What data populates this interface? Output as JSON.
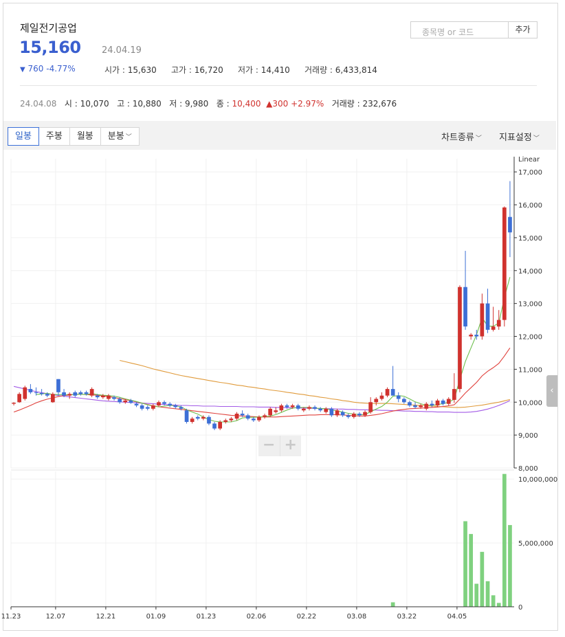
{
  "stock": {
    "name": "제일전기공업",
    "price": "15,160",
    "date": "24.04.19",
    "change_arrow": "▼",
    "change": "760 -4.77%",
    "open_label": "시가 : ",
    "open": "15,630",
    "high_label": "고가 : ",
    "high": "16,720",
    "low_label": "저가 : ",
    "low": "14,410",
    "volume_label": "거래량 : ",
    "volume": "6,433,814"
  },
  "search": {
    "placeholder": "종목명 or 코드",
    "add_label": "추가"
  },
  "hover_row": {
    "date": "24.04.08",
    "open_label": "시 : ",
    "open": "10,070",
    "high_label": "고 : ",
    "high": "10,880",
    "low_label": "저 : ",
    "low": "9,980",
    "close_label": "종 : ",
    "close": "10,400",
    "change_arrow": "▲",
    "change": "300 +2.97%",
    "volume_label": "거래량 : ",
    "volume": "232,676"
  },
  "toolbar": {
    "tabs": [
      {
        "label": "일봉"
      },
      {
        "label": "주봉"
      },
      {
        "label": "월봉"
      },
      {
        "label": "분봉"
      }
    ],
    "chart_type": "차트종류",
    "indicator": "지표설정"
  },
  "colors": {
    "up": "#d0322e",
    "down": "#3d6fd6",
    "volume": "#7fd17f",
    "ma5": "#6cbf4d",
    "ma20": "#e0413c",
    "ma60": "#e09a3a",
    "ma120": "#a259e6"
  },
  "icons": {
    "side_handle": "chevron-left-icon",
    "zoom_out": "minus-icon",
    "zoom_in": "plus-icon"
  },
  "chart_data": {
    "type": "candlestick",
    "scale_label": "Linear",
    "x_ticks": [
      "11.23",
      "12.07",
      "12.21",
      "01.09",
      "01.23",
      "02.06",
      "02.22",
      "03.08",
      "03.22",
      "04.05"
    ],
    "price_ylim": [
      8000,
      17400
    ],
    "price_ticks": [
      "17,000",
      "16,000",
      "15,000",
      "14,000",
      "13,000",
      "12,000",
      "11,000",
      "10,000",
      "9,000",
      "8,000"
    ],
    "volume_ylim": [
      0,
      10600000
    ],
    "volume_ticks": [
      "10,000,000",
      "5,000,000",
      "0"
    ],
    "candles": [
      {
        "o": 9950,
        "h": 10000,
        "l": 9900,
        "c": 9980
      },
      {
        "o": 10000,
        "h": 10300,
        "l": 9980,
        "c": 10250
      },
      {
        "o": 10100,
        "h": 10500,
        "l": 10050,
        "c": 10450
      },
      {
        "o": 10400,
        "h": 10550,
        "l": 10250,
        "c": 10300
      },
      {
        "o": 10300,
        "h": 10450,
        "l": 10200,
        "c": 10280
      },
      {
        "o": 10280,
        "h": 10400,
        "l": 10200,
        "c": 10250
      },
      {
        "o": 10250,
        "h": 10300,
        "l": 10150,
        "c": 10200
      },
      {
        "o": 10000,
        "h": 10300,
        "l": 9980,
        "c": 10250
      },
      {
        "o": 10700,
        "h": 10700,
        "l": 10200,
        "c": 10300
      },
      {
        "o": 10300,
        "h": 10400,
        "l": 10150,
        "c": 10200
      },
      {
        "o": 10200,
        "h": 10300,
        "l": 10100,
        "c": 10250
      },
      {
        "o": 10300,
        "h": 10350,
        "l": 10150,
        "c": 10200
      },
      {
        "o": 10300,
        "h": 10350,
        "l": 10200,
        "c": 10250
      },
      {
        "o": 10300,
        "h": 10350,
        "l": 10200,
        "c": 10250
      },
      {
        "o": 10200,
        "h": 10450,
        "l": 10150,
        "c": 10400
      },
      {
        "o": 10200,
        "h": 10250,
        "l": 10100,
        "c": 10150
      },
      {
        "o": 10150,
        "h": 10250,
        "l": 10100,
        "c": 10200
      },
      {
        "o": 10100,
        "h": 10250,
        "l": 10050,
        "c": 10200
      },
      {
        "o": 10150,
        "h": 10200,
        "l": 10050,
        "c": 10100
      },
      {
        "o": 10100,
        "h": 10150,
        "l": 9950,
        "c": 10000
      },
      {
        "o": 10000,
        "h": 10100,
        "l": 9950,
        "c": 10050
      },
      {
        "o": 10050,
        "h": 10100,
        "l": 9950,
        "c": 9980
      },
      {
        "o": 9950,
        "h": 10000,
        "l": 9850,
        "c": 9900
      },
      {
        "o": 9900,
        "h": 9950,
        "l": 9750,
        "c": 9800
      },
      {
        "o": 9850,
        "h": 9900,
        "l": 9750,
        "c": 9800
      },
      {
        "o": 9800,
        "h": 9950,
        "l": 9750,
        "c": 9900
      },
      {
        "o": 9900,
        "h": 10050,
        "l": 9850,
        "c": 10000
      },
      {
        "o": 10000,
        "h": 10050,
        "l": 9900,
        "c": 9950
      },
      {
        "o": 9950,
        "h": 10000,
        "l": 9850,
        "c": 9900
      },
      {
        "o": 9900,
        "h": 9950,
        "l": 9800,
        "c": 9850
      },
      {
        "o": 9850,
        "h": 9900,
        "l": 9750,
        "c": 9800
      },
      {
        "o": 9750,
        "h": 9800,
        "l": 9350,
        "c": 9400
      },
      {
        "o": 9400,
        "h": 9550,
        "l": 9350,
        "c": 9500
      },
      {
        "o": 9550,
        "h": 9600,
        "l": 9450,
        "c": 9500
      },
      {
        "o": 9500,
        "h": 9600,
        "l": 9450,
        "c": 9550
      },
      {
        "o": 9550,
        "h": 9600,
        "l": 9300,
        "c": 9350
      },
      {
        "o": 9350,
        "h": 9400,
        "l": 9150,
        "c": 9200
      },
      {
        "o": 9200,
        "h": 9450,
        "l": 9150,
        "c": 9400
      },
      {
        "o": 9400,
        "h": 9500,
        "l": 9350,
        "c": 9450
      },
      {
        "o": 9450,
        "h": 9550,
        "l": 9400,
        "c": 9500
      },
      {
        "o": 9500,
        "h": 9700,
        "l": 9450,
        "c": 9650
      },
      {
        "o": 9650,
        "h": 9750,
        "l": 9550,
        "c": 9600
      },
      {
        "o": 9600,
        "h": 9650,
        "l": 9450,
        "c": 9500
      },
      {
        "o": 9500,
        "h": 9550,
        "l": 9400,
        "c": 9450
      },
      {
        "o": 9450,
        "h": 9600,
        "l": 9400,
        "c": 9550
      },
      {
        "o": 9550,
        "h": 9650,
        "l": 9500,
        "c": 9600
      },
      {
        "o": 9600,
        "h": 9850,
        "l": 9550,
        "c": 9800
      },
      {
        "o": 9700,
        "h": 9850,
        "l": 9650,
        "c": 9750
      },
      {
        "o": 9750,
        "h": 9950,
        "l": 9700,
        "c": 9900
      },
      {
        "o": 9900,
        "h": 9950,
        "l": 9800,
        "c": 9850
      },
      {
        "o": 9850,
        "h": 9950,
        "l": 9800,
        "c": 9900
      },
      {
        "o": 9900,
        "h": 9950,
        "l": 9750,
        "c": 9800
      },
      {
        "o": 9750,
        "h": 9850,
        "l": 9700,
        "c": 9800
      },
      {
        "o": 9800,
        "h": 9900,
        "l": 9750,
        "c": 9850
      },
      {
        "o": 9850,
        "h": 9900,
        "l": 9750,
        "c": 9800
      },
      {
        "o": 9800,
        "h": 9850,
        "l": 9700,
        "c": 9750
      },
      {
        "o": 9700,
        "h": 9850,
        "l": 9650,
        "c": 9800
      },
      {
        "o": 9800,
        "h": 9850,
        "l": 9550,
        "c": 9600
      },
      {
        "o": 9600,
        "h": 9800,
        "l": 9550,
        "c": 9750
      },
      {
        "o": 9700,
        "h": 9750,
        "l": 9550,
        "c": 9600
      },
      {
        "o": 9600,
        "h": 9650,
        "l": 9500,
        "c": 9550
      },
      {
        "o": 9550,
        "h": 9700,
        "l": 9500,
        "c": 9650
      },
      {
        "o": 9650,
        "h": 9700,
        "l": 9550,
        "c": 9600
      },
      {
        "o": 9600,
        "h": 9750,
        "l": 9550,
        "c": 9700
      },
      {
        "o": 9700,
        "h": 10150,
        "l": 9650,
        "c": 10000
      },
      {
        "o": 10000,
        "h": 10150,
        "l": 9900,
        "c": 10100
      },
      {
        "o": 10100,
        "h": 10300,
        "l": 10050,
        "c": 10200
      },
      {
        "o": 10200,
        "h": 10450,
        "l": 10150,
        "c": 10400
      },
      {
        "o": 10400,
        "h": 11100,
        "l": 10250,
        "c": 10200
      },
      {
        "o": 10200,
        "h": 10300,
        "l": 10000,
        "c": 10100
      },
      {
        "o": 10100,
        "h": 10150,
        "l": 9950,
        "c": 10000
      },
      {
        "o": 10000,
        "h": 10050,
        "l": 9850,
        "c": 9900
      },
      {
        "o": 9900,
        "h": 10000,
        "l": 9800,
        "c": 9850
      },
      {
        "o": 9850,
        "h": 9950,
        "l": 9800,
        "c": 9900
      },
      {
        "o": 9800,
        "h": 10000,
        "l": 9750,
        "c": 9950
      },
      {
        "o": 9950,
        "h": 10050,
        "l": 9850,
        "c": 9900
      },
      {
        "o": 9900,
        "h": 10100,
        "l": 9850,
        "c": 10050
      },
      {
        "o": 10050,
        "h": 10100,
        "l": 9900,
        "c": 9950
      },
      {
        "o": 9950,
        "h": 10150,
        "l": 9900,
        "c": 10100
      },
      {
        "o": 10070,
        "h": 10880,
        "l": 9980,
        "c": 10400
      },
      {
        "o": 10400,
        "h": 13550,
        "l": 10300,
        "c": 13500
      },
      {
        "o": 13500,
        "h": 14600,
        "l": 12200,
        "c": 12300
      },
      {
        "o": 12000,
        "h": 12100,
        "l": 11900,
        "c": 12050
      },
      {
        "o": 12050,
        "h": 12200,
        "l": 11900,
        "c": 12000
      },
      {
        "o": 12000,
        "h": 13300,
        "l": 11900,
        "c": 13000
      },
      {
        "o": 13000,
        "h": 13450,
        "l": 12100,
        "c": 12200
      },
      {
        "o": 12200,
        "h": 12900,
        "l": 12150,
        "c": 12300
      },
      {
        "o": 12300,
        "h": 12800,
        "l": 12200,
        "c": 12500
      },
      {
        "o": 12500,
        "h": 15950,
        "l": 12300,
        "c": 15920
      },
      {
        "o": 15630,
        "h": 16720,
        "l": 14410,
        "c": 15160
      }
    ],
    "volumes": [
      0,
      0,
      0,
      0,
      0,
      0,
      0,
      0,
      0,
      0,
      0,
      0,
      0,
      0,
      0,
      0,
      0,
      0,
      0,
      0,
      0,
      0,
      0,
      0,
      0,
      0,
      0,
      0,
      0,
      0,
      0,
      0,
      0,
      0,
      0,
      0,
      0,
      0,
      0,
      0,
      0,
      0,
      0,
      0,
      0,
      0,
      0,
      0,
      0,
      0,
      0,
      0,
      0,
      0,
      0,
      0,
      0,
      0,
      0,
      0,
      0,
      0,
      0,
      0,
      0,
      0,
      0,
      0,
      350000,
      0,
      0,
      0,
      0,
      0,
      0,
      0,
      0,
      0,
      0,
      0,
      0,
      6700000,
      5700000,
      1800000,
      4300000,
      2000000,
      900000,
      300000,
      10400000,
      6400000
    ],
    "ma5": [
      null,
      null,
      null,
      null,
      10230,
      10250,
      10270,
      10230,
      10230,
      10230,
      10220,
      10240,
      10240,
      10230,
      10260,
      10230,
      10210,
      10200,
      10180,
      10150,
      10100,
      10060,
      10020,
      9970,
      9920,
      9880,
      9860,
      9880,
      9900,
      9890,
      9860,
      9770,
      9700,
      9640,
      9550,
      9470,
      9420,
      9400,
      9400,
      9400,
      9440,
      9520,
      9540,
      9540,
      9550,
      9560,
      9580,
      9620,
      9690,
      9760,
      9820,
      9840,
      9840,
      9840,
      9820,
      9810,
      9800,
      9760,
      9740,
      9700,
      9660,
      9640,
      9620,
      9620,
      9710,
      9790,
      9870,
      10000,
      10180,
      10200,
      10180,
      10100,
      10010,
      9950,
      9910,
      9900,
      9930,
      9950,
      10000,
      10090,
      10680,
      11240,
      11650,
      12050,
      12570,
      12310,
      12310,
      12400,
      13180,
      13800
    ],
    "ma20": [
      9700,
      9760,
      9830,
      9900,
      9980,
      10040,
      10090,
      10130,
      10170,
      10200,
      10220,
      10240,
      10240,
      10230,
      10220,
      10210,
      10190,
      10170,
      10140,
      10110,
      10080,
      10050,
      10010,
      9970,
      9930,
      9890,
      9860,
      9840,
      9820,
      9800,
      9780,
      9760,
      9740,
      9720,
      9700,
      9680,
      9660,
      9640,
      9620,
      9600,
      9590,
      9580,
      9570,
      9560,
      9550,
      9550,
      9550,
      9550,
      9560,
      9570,
      9580,
      9590,
      9600,
      9610,
      9610,
      9620,
      9620,
      9620,
      9620,
      9610,
      9600,
      9590,
      9580,
      9580,
      9600,
      9620,
      9650,
      9690,
      9730,
      9760,
      9780,
      9800,
      9810,
      9820,
      9830,
      9840,
      9850,
      9870,
      9890,
      9920,
      10090,
      10280,
      10440,
      10600,
      10800,
      10940,
      11050,
      11180,
      11400,
      11650
    ],
    "ma60": [
      null,
      null,
      null,
      null,
      null,
      null,
      null,
      null,
      null,
      null,
      null,
      null,
      null,
      null,
      null,
      null,
      null,
      null,
      null,
      11270,
      11230,
      11190,
      11150,
      11110,
      11060,
      11010,
      10970,
      10930,
      10890,
      10850,
      10810,
      10780,
      10750,
      10720,
      10690,
      10660,
      10630,
      10600,
      10580,
      10550,
      10520,
      10500,
      10470,
      10450,
      10420,
      10400,
      10370,
      10350,
      10330,
      10300,
      10280,
      10250,
      10230,
      10200,
      10180,
      10150,
      10130,
      10100,
      10080,
      10050,
      10030,
      10000,
      9980,
      9970,
      9960,
      9960,
      9960,
      9960,
      9950,
      9940,
      9930,
      9920,
      9910,
      9900,
      9890,
      9880,
      9870,
      9860,
      9850,
      9840,
      9840,
      9850,
      9870,
      9890,
      9910,
      9940,
      9970,
      10000,
      10040,
      10080
    ],
    "ma120": [
      10480,
      10440,
      10400,
      10360,
      10320,
      10290,
      10260,
      10230,
      10200,
      10180,
      10160,
      10140,
      10120,
      10100,
      10080,
      10060,
      10040,
      10030,
      10020,
      10010,
      10000,
      9990,
      9980,
      9970,
      9960,
      9950,
      9940,
      9930,
      9920,
      9910,
      9900,
      9900,
      9890,
      9890,
      9880,
      9880,
      9880,
      9870,
      9870,
      9870,
      9870,
      9860,
      9860,
      9860,
      9850,
      9850,
      9850,
      9840,
      9840,
      9830,
      9830,
      9830,
      9820,
      9820,
      9810,
      9810,
      9800,
      9800,
      9790,
      9790,
      9780,
      9780,
      9770,
      9770,
      9760,
      9760,
      9750,
      9750,
      9740,
      9740,
      9730,
      9730,
      9720,
      9720,
      9710,
      9710,
      9700,
      9700,
      9700,
      9690,
      9690,
      9690,
      9700,
      9720,
      9750,
      9790,
      9840,
      9900,
      9970,
      10050
    ]
  }
}
